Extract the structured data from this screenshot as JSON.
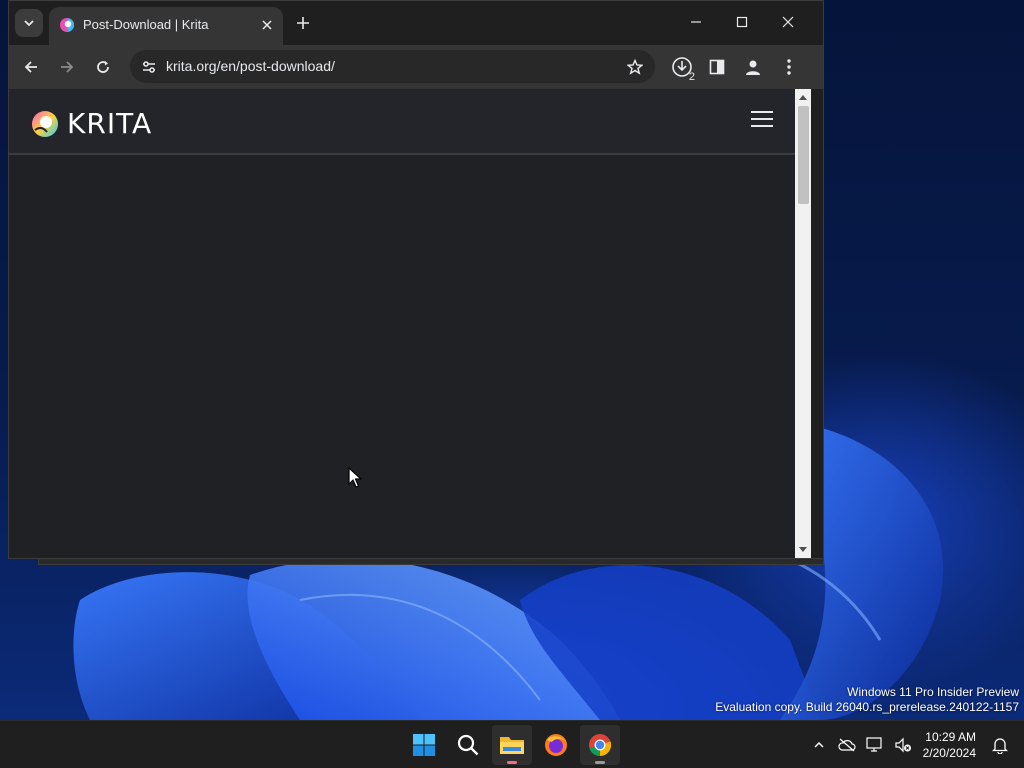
{
  "browser": {
    "tab_title": "Post-Download | Krita",
    "url": "krita.org/en/post-download/",
    "downloads_count": "2"
  },
  "site": {
    "logo_text": "KRITA"
  },
  "watermark": {
    "line1": "Windows 11 Pro Insider Preview",
    "line2": "Evaluation copy. Build 26040.rs_prerelease.240122-1157"
  },
  "clock": {
    "time": "10:29 AM",
    "date": "2/20/2024"
  },
  "taskbar": {
    "apps": [
      "start-icon",
      "search-icon",
      "file-explorer-icon",
      "firefox-icon",
      "chrome-icon"
    ]
  },
  "colors": {
    "accent_blue": "#1c4fe0",
    "chrome_dark": "#1f1f1f",
    "site_bg": "#1f2124"
  }
}
